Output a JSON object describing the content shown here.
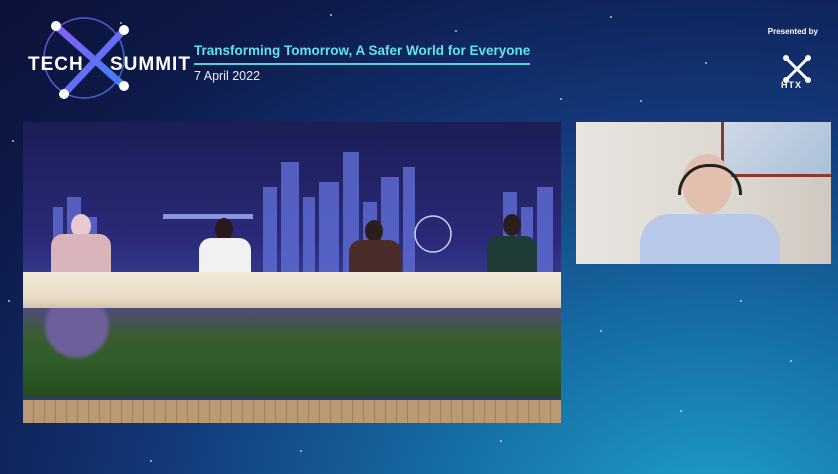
{
  "brand": {
    "logo_word_1": "TECH",
    "logo_word_2": "SUMMIT",
    "accent_color": "#5fe3ef"
  },
  "header": {
    "tagline": "Transforming Tomorrow, A Safer World for Everyone",
    "date": "7 April 2022"
  },
  "sponsor": {
    "presented_by": "Presented by",
    "org": "HTX"
  },
  "videos": {
    "stage": {
      "panelists": 4
    },
    "remote": {
      "participants": 1
    }
  }
}
